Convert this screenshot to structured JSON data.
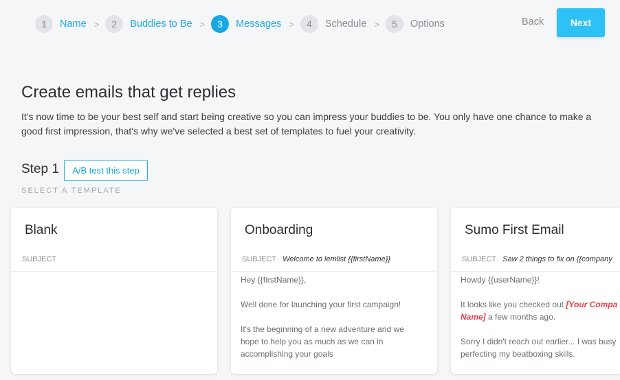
{
  "stepper": {
    "steps": [
      {
        "num": "1",
        "label": "Name"
      },
      {
        "num": "2",
        "label": "Buddies to Be"
      },
      {
        "num": "3",
        "label": "Messages"
      },
      {
        "num": "4",
        "label": "Schedule"
      },
      {
        "num": "5",
        "label": "Options"
      }
    ],
    "separator": ">",
    "back_label": "Back",
    "next_label": "Next"
  },
  "page": {
    "title": "Create emails that get replies",
    "intro": "It's now time to be your best self and start being creative so you can impress your buddies to be. You only have one chance to make a good first impression, that's why we've selected a best set of templates to fuel your creativity."
  },
  "step_section": {
    "title": "Step 1",
    "ab_test_label": "A/B test this step",
    "select_label": "SELECT A TEMPLATE"
  },
  "templates": [
    {
      "title": "Blank",
      "subject_label": "SUBJECT",
      "subject_value": ""
    },
    {
      "title": "Onboarding",
      "subject_label": "SUBJECT",
      "subject_value": "Welcome to lemlist {{firstName}}",
      "body": {
        "l1": "Hey {{firstName}},",
        "l2": "Well done for launching your first campaign!",
        "l3a": "It's the beginning of a new adventure and we",
        "l3b": "hope to help you as much as we can in",
        "l3c": "accomplishing your goals"
      }
    },
    {
      "title": "Sumo First Email",
      "subject_label": "SUBJECT",
      "subject_value": "Saw 2 things to fix on {{company",
      "body": {
        "l1": "Howdy {{userName}}!",
        "l2a_pre": "It looks like you checked out ",
        "l2a_hl": "[Your Compa",
        "l2b_hl": "Name]",
        "l2b_post": " a few months ago.",
        "l3a": "Sorry I didn't reach out earlier... I was busy",
        "l3b": "perfecting my beatboxing skills."
      }
    }
  ]
}
